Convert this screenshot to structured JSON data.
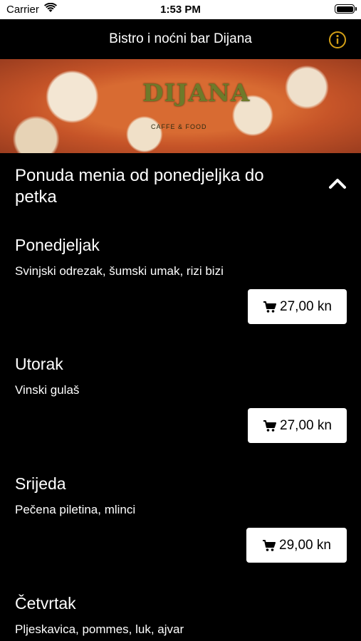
{
  "status_bar": {
    "carrier": "Carrier",
    "time": "1:53 PM"
  },
  "nav": {
    "title": "Bistro i noćni bar Dijana"
  },
  "hero": {
    "logo_text": "DIJANA",
    "logo_subtext": "CAFFE & FOOD"
  },
  "section": {
    "title": "Ponuda menia od ponedjeljka do petka"
  },
  "items": [
    {
      "day": "Ponedjeljak",
      "description": "Svinjski odrezak, šumski umak, rizi bizi",
      "price": "27,00 kn"
    },
    {
      "day": "Utorak",
      "description": "Vinski gulaš",
      "price": "27,00 kn"
    },
    {
      "day": "Srijeda",
      "description": "Pečena piletina, mlinci",
      "price": "29,00 kn"
    },
    {
      "day": "Četvrtak",
      "description": "Pljeskavica, pommes, luk, ajvar",
      "price": ""
    }
  ],
  "colors": {
    "accent": "#d4a017",
    "background": "#000000",
    "button_bg": "#ffffff"
  },
  "icons": {
    "info": "info-icon",
    "chevron": "chevron-up-icon",
    "cart": "cart-icon"
  }
}
